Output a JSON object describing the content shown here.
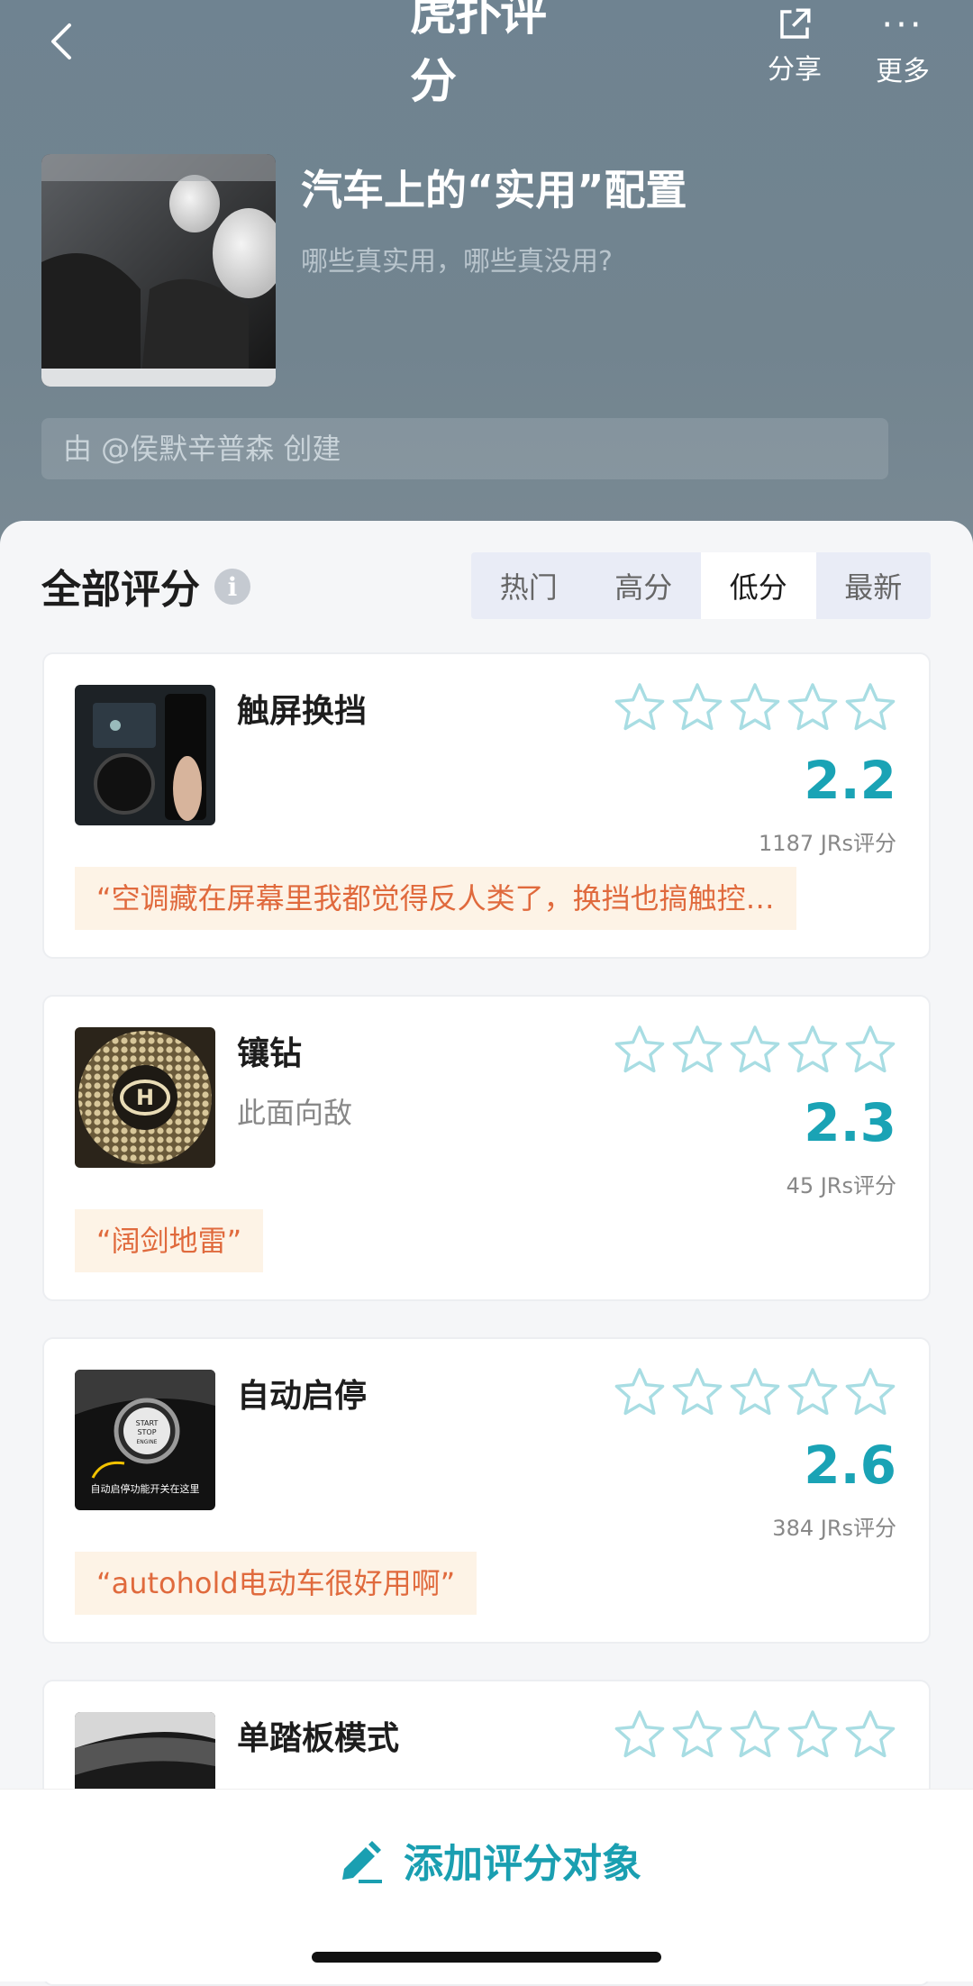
{
  "header": {
    "app_logo": "虎扑评分",
    "share_label": "分享",
    "more_label": "更多",
    "topic_title": "汽车上的“实用”配置",
    "topic_subtitle": "哪些真实用，哪些真没用?",
    "creator": "由 @侯默辛普森 创建"
  },
  "section": {
    "title": "全部评分",
    "tabs": [
      {
        "label": "热门",
        "active": false
      },
      {
        "label": "高分",
        "active": false
      },
      {
        "label": "低分",
        "active": true
      },
      {
        "label": "最新",
        "active": false
      }
    ]
  },
  "items": [
    {
      "name": "触屏换挡",
      "subtitle": "",
      "score": "2.2",
      "count": "1187 JRs评分",
      "quote": "“空调藏在屏幕里我都觉得反人类了，换挡也搞触控…",
      "stars_filled": 0
    },
    {
      "name": "镶钻",
      "subtitle": "此面向敌",
      "score": "2.3",
      "count": "45 JRs评分",
      "quote": "“阔剑地雷”",
      "stars_filled": 0
    },
    {
      "name": "自动启停",
      "subtitle": "",
      "score": "2.6",
      "count": "384 JRs评分",
      "quote": "“autohold电动车很好用啊”",
      "stars_filled": 0
    },
    {
      "name": "单踏板模式",
      "subtitle": "",
      "score": "",
      "count": "",
      "quote": "",
      "stars_filled": 0
    }
  ],
  "thumb_text": {
    "engine_start": "START\nSTOP\nENGINE",
    "engine_caption": "自动启停功能开关在这里"
  },
  "bottom": {
    "add_label": "添加评分对象"
  },
  "colors": {
    "accent": "#1aa3b5",
    "quote_text": "#e06a3d",
    "quote_bg": "#fdf3e6",
    "header_bg": "#72848f"
  }
}
